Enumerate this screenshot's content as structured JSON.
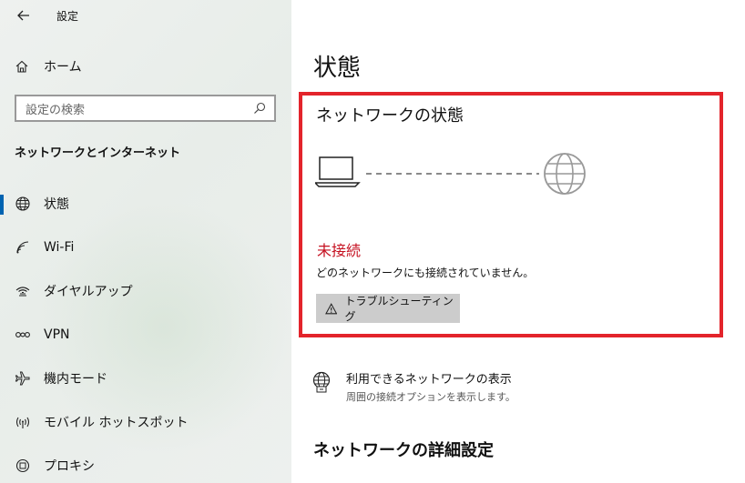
{
  "window": {
    "title": "設定",
    "back_icon": "back-arrow-icon"
  },
  "sidebar": {
    "home": {
      "label": "ホーム",
      "icon": "home-icon"
    },
    "search": {
      "placeholder": "設定の検索",
      "icon": "search-icon"
    },
    "section_title": "ネットワークとインターネット",
    "items": [
      {
        "label": "状態",
        "icon": "globe-status-icon",
        "selected": true
      },
      {
        "label": "Wi-Fi",
        "icon": "wifi-icon",
        "selected": false
      },
      {
        "label": "ダイヤルアップ",
        "icon": "dialup-icon",
        "selected": false
      },
      {
        "label": "VPN",
        "icon": "vpn-icon",
        "selected": false
      },
      {
        "label": "機内モード",
        "icon": "airplane-icon",
        "selected": false
      },
      {
        "label": "モバイル ホットスポット",
        "icon": "hotspot-icon",
        "selected": false
      },
      {
        "label": "プロキシ",
        "icon": "proxy-icon",
        "selected": false
      }
    ]
  },
  "main": {
    "page_title": "状態",
    "network_status": {
      "heading": "ネットワークの状態",
      "status": "未接続",
      "description": "どのネットワークにも接続されていません。",
      "troubleshoot_label": "トラブルシューティング",
      "troubleshoot_icon": "warning-icon",
      "diagram_icons": [
        "laptop-icon",
        "globe-icon"
      ]
    },
    "available_networks": {
      "title": "利用できるネットワークの表示",
      "subtitle": "周囲の接続オプションを表示します。",
      "icon": "globe-network-icon"
    },
    "advanced_heading": "ネットワークの詳細設定"
  },
  "colors": {
    "accent": "#0063b1",
    "highlight_border": "#e3242b",
    "status_error": "#c50f1f",
    "button_bg": "#cccccc"
  }
}
